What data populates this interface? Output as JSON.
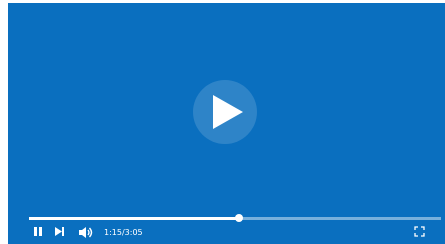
{
  "player": {
    "background_color": "#0a6fbf",
    "big_play_icon": "play-icon",
    "progress": {
      "played_fraction": 0.51
    },
    "controls": {
      "pause_icon": "pause-icon",
      "next_icon": "skip-next-icon",
      "volume_icon": "volume-icon",
      "fullscreen_icon": "fullscreen-icon",
      "time_display": "1:15/3:05"
    }
  }
}
